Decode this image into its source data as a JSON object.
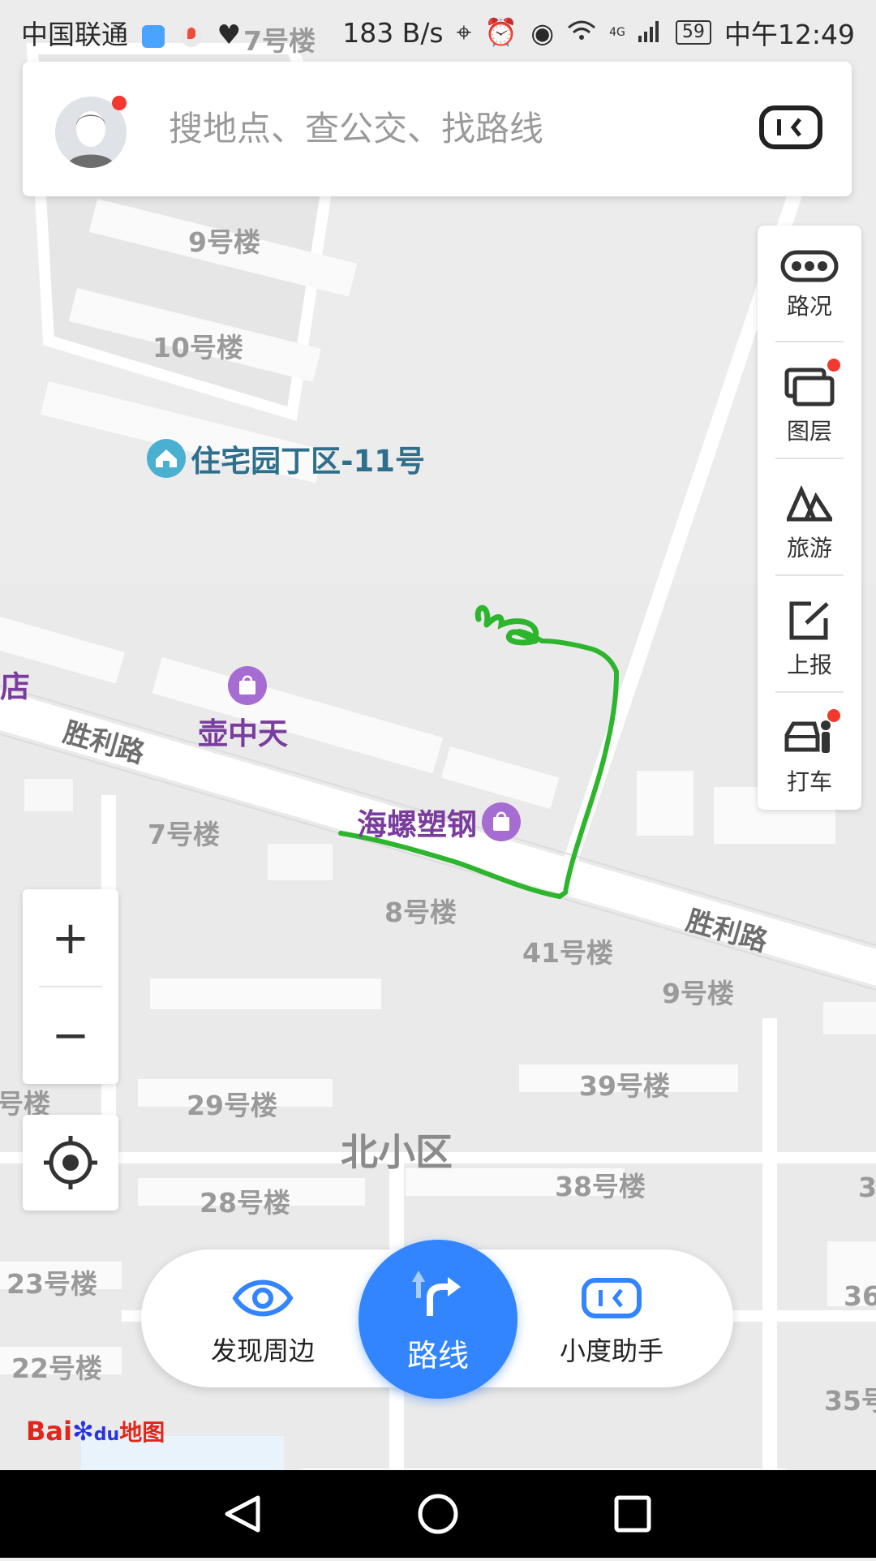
{
  "status_bar": {
    "carrier": "中国联通",
    "speed": "183 B/s",
    "network": "4G",
    "battery": "59",
    "time": "中午12:49"
  },
  "search": {
    "placeholder": "搜地点、查公交、找路线"
  },
  "tools": [
    {
      "label": "路况",
      "icon": "traffic-icon"
    },
    {
      "label": "图层",
      "icon": "layers-icon"
    },
    {
      "label": "旅游",
      "icon": "travel-icon"
    },
    {
      "label": "上报",
      "icon": "report-icon"
    },
    {
      "label": "打车",
      "icon": "taxi-icon"
    }
  ],
  "zoom": {
    "in": "+",
    "out": "−"
  },
  "map": {
    "buildings": [
      "7号楼",
      "9号楼",
      "10号楼",
      "7号楼",
      "8号楼",
      "41号楼",
      "9号楼",
      "39号楼",
      "29号楼",
      "38号楼",
      "28号楼",
      "23号楼",
      "22号楼",
      "号楼",
      "36",
      "35号",
      "3"
    ],
    "pois": {
      "residential": "住宅园丁区-11号",
      "shop1": "壶中天",
      "shop2": "海螺塑钢",
      "partial": "店"
    },
    "roads": {
      "west": "胜利路",
      "east": "胜利路"
    },
    "area": "北小区",
    "drawn_path_color": "#2db52d"
  },
  "actions": {
    "discover": "发现周边",
    "route": "路线",
    "assistant": "小度助手"
  },
  "logo": {
    "bai": "Bai",
    "du": "du",
    "map": "地图"
  },
  "colors": {
    "accent": "#3385ff",
    "poi_purple": "#7a3d9e",
    "notification": "#f2382f"
  }
}
